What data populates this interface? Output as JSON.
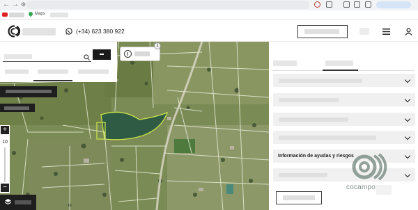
{
  "browser": {
    "bookmarks": [
      {
        "label": "Maps"
      }
    ]
  },
  "header": {
    "phone": "(+34) 623 380 922"
  },
  "map": {
    "info_badge_count": "1",
    "zoom_plus": "+",
    "zoom_level": "10",
    "zoom_minus": "−"
  },
  "right_panel": {
    "accordion_label": "Información de ayudas y riesgos"
  },
  "watermark": {
    "text": "cocampo"
  },
  "colors": {
    "water": "#2f5a44",
    "field_green": "#6f8445",
    "boundary_lines": "#e8ecd8",
    "dark_controls": "#1e1e1e"
  },
  "icons": [
    "back-icon",
    "forward-icon",
    "tune-icon",
    "youtube-icon",
    "maps-pin-icon",
    "whatsapp-icon",
    "menu-icon",
    "user-icon",
    "search-icon",
    "info-icon",
    "zoom-plus-icon",
    "zoom-minus-icon",
    "layers-icon",
    "chevron-down-icon"
  ]
}
